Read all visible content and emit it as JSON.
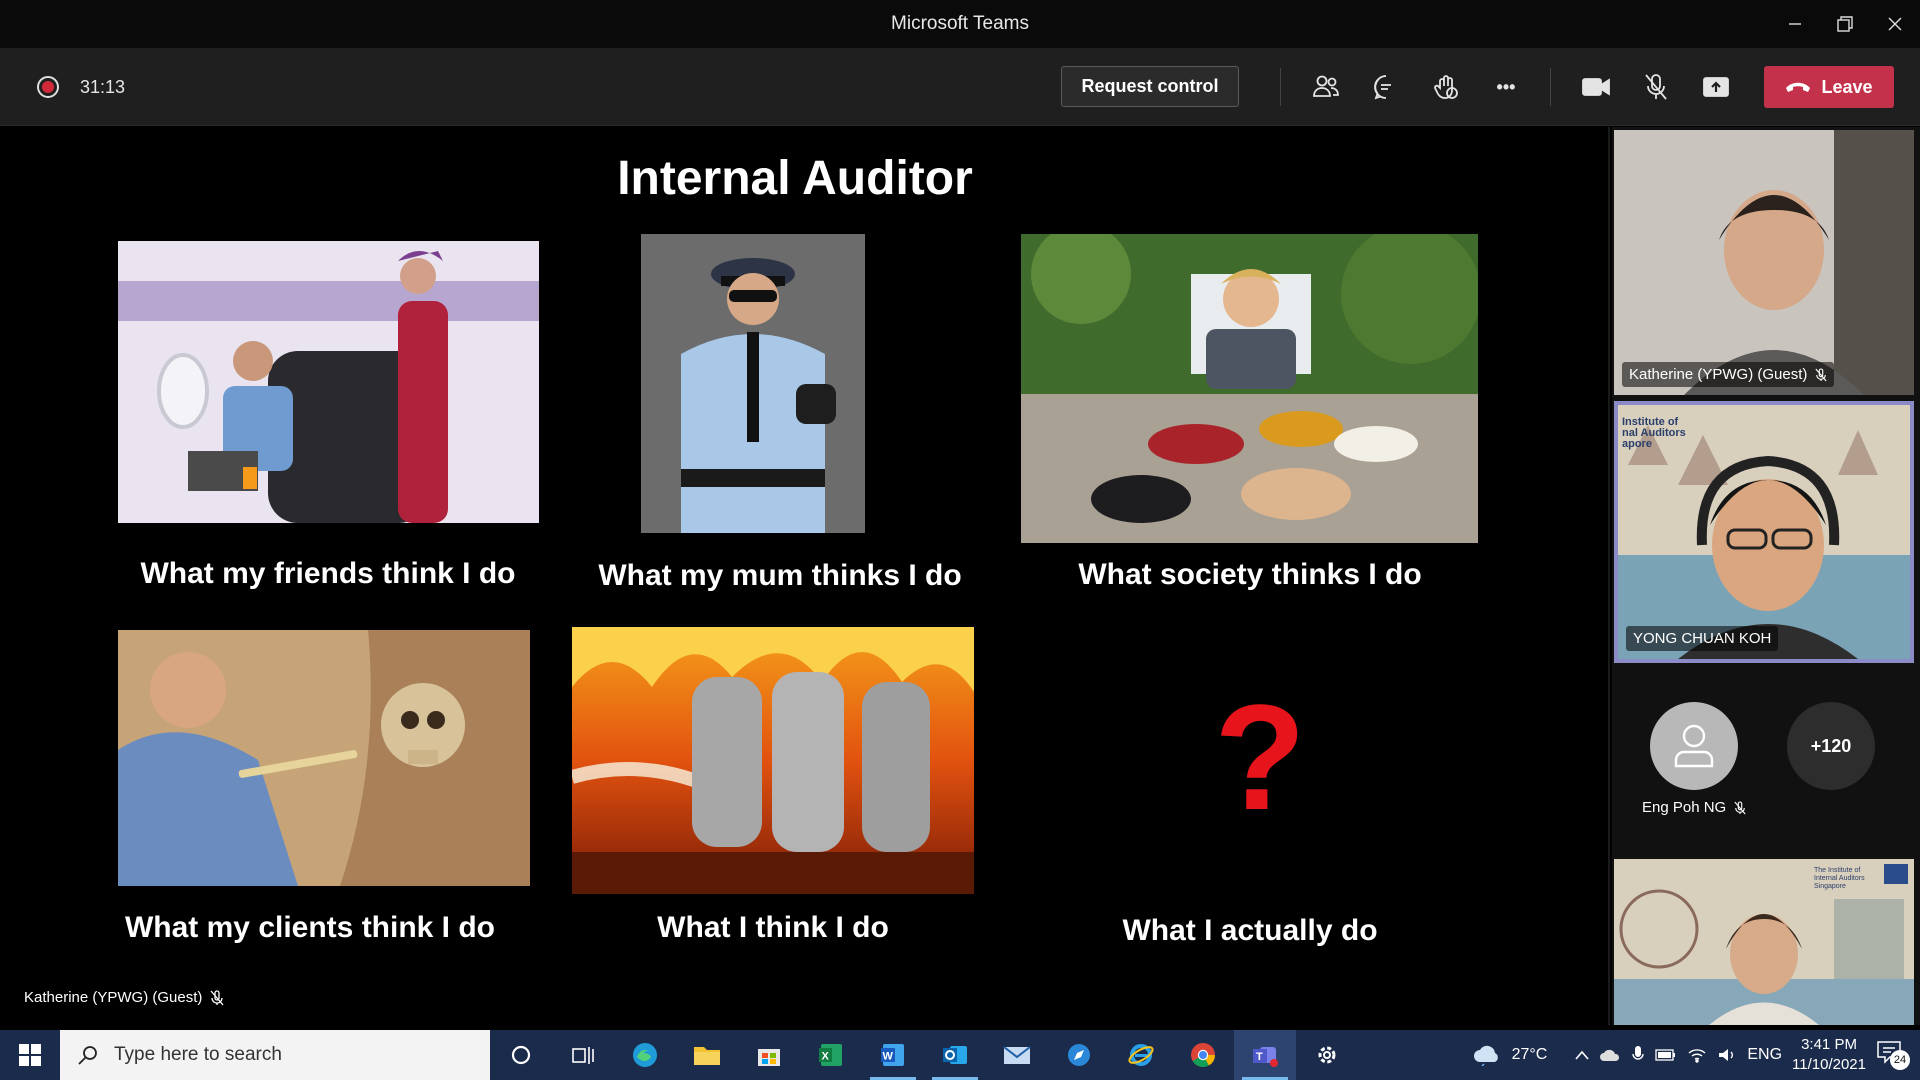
{
  "window": {
    "title": "Microsoft Teams"
  },
  "toolbar": {
    "timer": "31:13",
    "request_control_label": "Request control",
    "leave_label": "Leave",
    "more_label": "•••"
  },
  "slide": {
    "title": "Internal Auditor",
    "captions": [
      "What my friends think I do",
      "What my mum thinks I do",
      "What society thinks I do",
      "What my clients think I do",
      "What I think I do",
      "What I actually do"
    ],
    "question_mark": "?"
  },
  "stage": {
    "speaker_name": "Katherine (YPWG) (Guest)"
  },
  "participants": {
    "tile1_name": "Katherine (YPWG) (Guest)",
    "tile2_name": "YONG CHUAN KOH",
    "tile2_background_text": "Institute of\nnal Auditors\napore",
    "avatar_name": "Eng Poh NG",
    "overflow_count": "+120",
    "tile4_logo_text": "The Institute of\nInternal Auditors\nSingapore"
  },
  "taskbar": {
    "search_placeholder": "Type here to search",
    "weather_temp": "27°C",
    "language": "ENG",
    "time": "3:41 PM",
    "date": "11/10/2021",
    "notification_count": "24"
  },
  "colors": {
    "leave_red": "#c4314b",
    "record_red": "#d2293a",
    "active_tile_border": "#8b8cc7",
    "taskbar_bg": "#1b2b4b",
    "question_red": "#e8141b"
  }
}
